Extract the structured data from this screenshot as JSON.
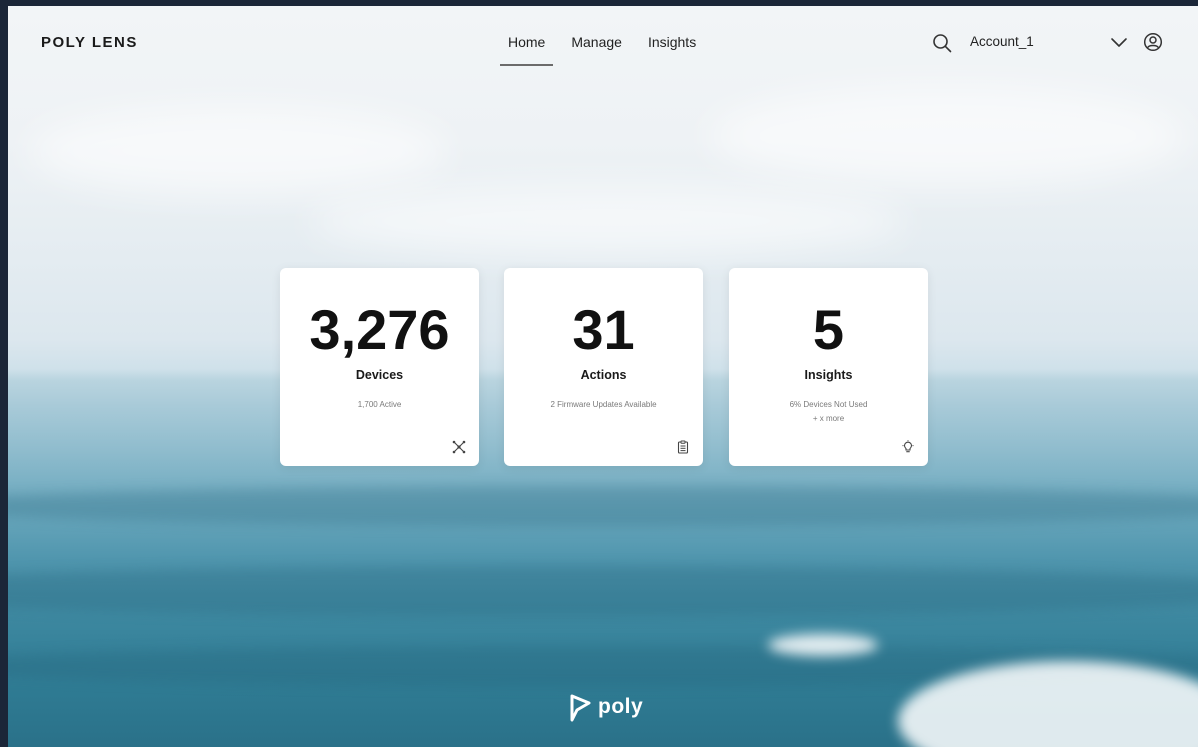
{
  "header": {
    "brand": "POLY LENS",
    "nav": [
      {
        "label": "Home",
        "active": true
      },
      {
        "label": "Manage",
        "active": false
      },
      {
        "label": "Insights",
        "active": false
      }
    ],
    "account": "Account_1",
    "icons": {
      "search": "search-icon",
      "dropdown": "chevron-down-icon",
      "profile": "user-circle-icon"
    }
  },
  "cards": [
    {
      "value": "3,276",
      "label": "Devices",
      "sub": [
        "1,700 Active"
      ],
      "icon": "network-icon"
    },
    {
      "value": "31",
      "label": "Actions",
      "sub": [
        "2 Firmware Updates Available"
      ],
      "icon": "clipboard-icon"
    },
    {
      "value": "5",
      "label": "Insights",
      "sub": [
        "6% Devices Not Used",
        "+ x more"
      ],
      "icon": "lightbulb-icon"
    }
  ],
  "footer": {
    "logo_text": "poly",
    "logo_icon": "poly-logo-icon"
  },
  "colors": {
    "text": "#1a1a1a",
    "card_bg": "#ffffff",
    "sea": "#2f7b93",
    "sky": "#eef2f5"
  }
}
